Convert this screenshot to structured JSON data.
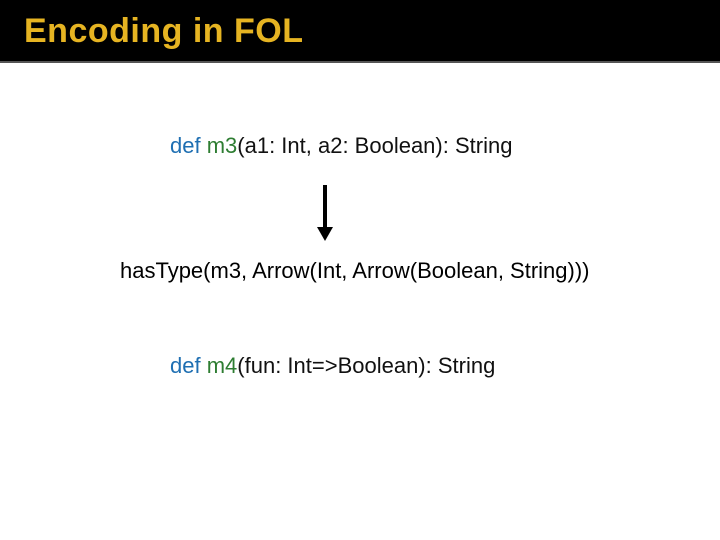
{
  "title": "Encoding in FOL",
  "sig1": {
    "def": "def",
    "name": " m3",
    "params": "(a1: Int, a2: Boolean): String"
  },
  "fol": "hasType(m3,  Arrow(Int, Arrow(Boolean, String)))",
  "sig2": {
    "def": "def",
    "name": " m4",
    "params": "(fun: Int=>Boolean): String"
  }
}
